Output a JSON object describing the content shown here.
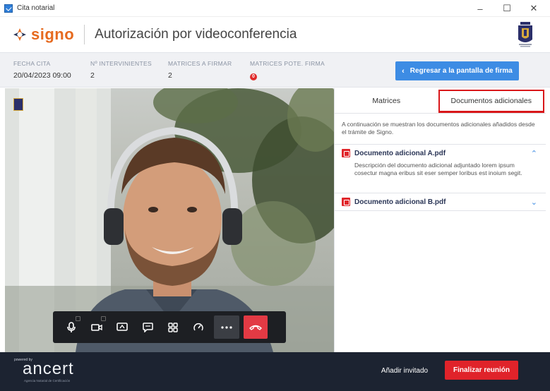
{
  "window": {
    "title": "Cita notarial",
    "minimize": "–",
    "maximize": "☐",
    "close": "✕"
  },
  "header": {
    "logo_text": "signo",
    "title": "Autorización por videoconferencia"
  },
  "info": {
    "fecha_label": "FECHA CITA",
    "fecha_value": "20/04/2023 09:00",
    "intervinientes_label": "Nº INTERVINIENTES",
    "intervinientes_value": "2",
    "matrices_label": "MATRICES A FIRMAR",
    "matrices_value": "2",
    "pote_label": "MATRICES POTE. FIRMA",
    "pote_value": "0",
    "back_button": "Regresar a la pantalla de firma"
  },
  "tabs": {
    "matrices": "Matrices",
    "documentos": "Documentos adicionales"
  },
  "panel": {
    "intro": "A continuación se muestran los documentos adicionales añadidos desde el trámite de Signo.",
    "docs": [
      {
        "title": "Documento adicional A.pdf",
        "description": "Descripción del documento adicional adjuntado lorem ipsum cosectur magna eribus sit eser semper loribus est inoium segit.",
        "toggle": "⌃"
      },
      {
        "title": "Documento adicional B.pdf",
        "toggle": "⌄"
      }
    ]
  },
  "footer": {
    "powered": "powered by",
    "logo": "ancert",
    "tagline": "Agencia Notarial de Certificación",
    "invite_button": "Añadir invitado",
    "end_button": "Finalizar reunión"
  },
  "colors": {
    "brand_orange": "#e66a1f",
    "primary_blue": "#3d8ce4",
    "danger_red": "#e0232a",
    "footer_bg": "#1c2331"
  }
}
